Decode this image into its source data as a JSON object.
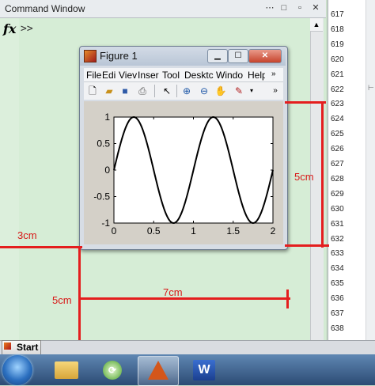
{
  "command_window": {
    "title": "Command Window",
    "prompt": ">>",
    "fx_label": "fx",
    "title_icons": [
      "ellipsis-icon",
      "dock-icon",
      "close-icon"
    ]
  },
  "line_numbers": [
    "617",
    "618",
    "619",
    "620",
    "621",
    "622",
    "623",
    "624",
    "625",
    "626",
    "627",
    "628",
    "629",
    "630",
    "631",
    "632",
    "633",
    "634",
    "635",
    "636",
    "637",
    "638"
  ],
  "figure": {
    "title": "Figure 1",
    "menu": [
      "File",
      "Edit",
      "View",
      "Insert",
      "Tools",
      "Desktop",
      "Window",
      "Help"
    ],
    "menu_display": [
      "File",
      "Edi",
      "Viev",
      "Inser",
      "Tool",
      "Desktc",
      "Windo",
      "Help"
    ],
    "toolbar_icons": [
      "new-figure-icon",
      "open-icon",
      "save-icon",
      "print-icon",
      "pointer-icon",
      "zoom-in-icon",
      "zoom-out-icon",
      "pan-icon",
      "data-cursor-icon"
    ]
  },
  "annotations": {
    "left_offset": "3cm",
    "bottom_offset": "5cm",
    "width_label": "7cm",
    "height_label": "5cm"
  },
  "start_button": "Start",
  "chart_data": {
    "type": "line",
    "title": "",
    "xlabel": "",
    "ylabel": "",
    "xlim": [
      0,
      2
    ],
    "ylim": [
      -1,
      1
    ],
    "xticks": [
      0,
      0.5,
      1,
      1.5,
      2
    ],
    "xtick_labels": [
      "0",
      "0.5",
      "1",
      "1.5",
      "2"
    ],
    "yticks": [
      1,
      0.5,
      0,
      -0.5,
      -1
    ],
    "ytick_labels": [
      "1",
      "0.5",
      "0",
      "-0.5",
      "-1"
    ],
    "series": [
      {
        "color": "#000000",
        "x": [
          0,
          0.125,
          0.25,
          0.375,
          0.5,
          0.625,
          0.75,
          0.875,
          1,
          1.125,
          1.25,
          1.375,
          1.5,
          1.625,
          1.75,
          1.875,
          2
        ],
        "y": [
          0,
          0.707,
          1,
          0.707,
          0,
          -0.707,
          -1,
          -0.707,
          0,
          0.707,
          1,
          0.707,
          0,
          -0.707,
          -1,
          -0.707,
          0
        ]
      }
    ],
    "grid": false
  }
}
